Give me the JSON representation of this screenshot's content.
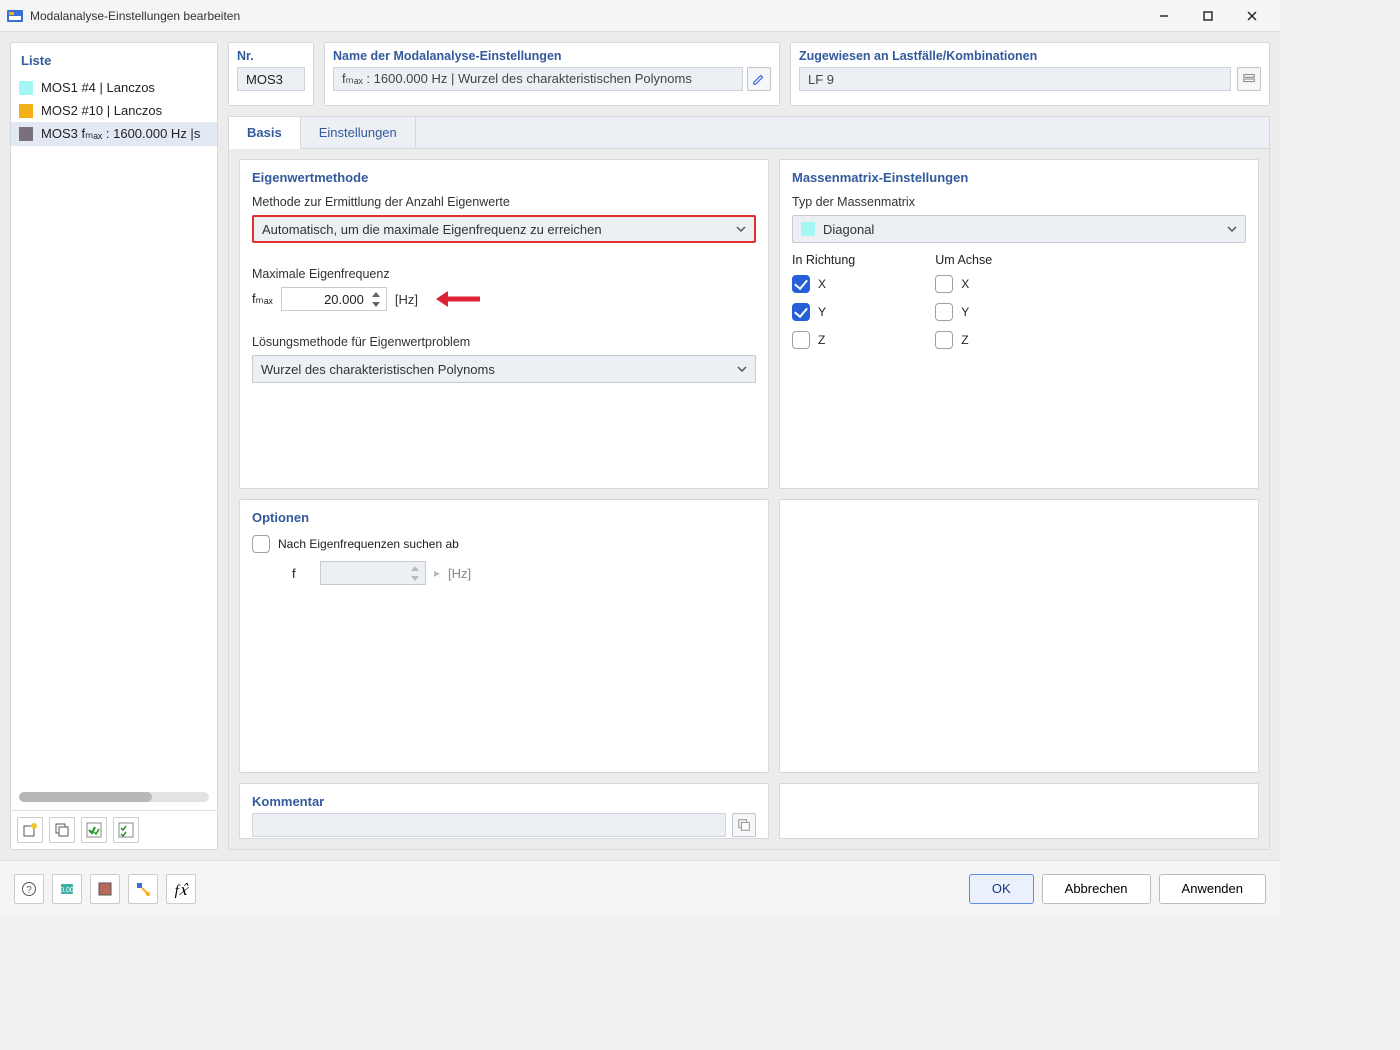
{
  "window": {
    "title": "Modalanalyse-Einstellungen bearbeiten"
  },
  "liste": {
    "heading": "Liste",
    "items": [
      {
        "color": "#a5f7f3",
        "label": "MOS1 #4 | Lanczos"
      },
      {
        "color": "#f4b117",
        "label": "MOS2 #10 | Lanczos"
      },
      {
        "color": "#7a6f7a",
        "label": "MOS3 fₘₐₓ : 1600.000 Hz |s"
      }
    ]
  },
  "top": {
    "nr_label": "Nr.",
    "nr_value": "MOS3",
    "name_label": "Name der Modalanalyse-Einstellungen",
    "name_value": "fₘₐₓ : 1600.000 Hz | Wurzel des charakteristischen Polynoms",
    "assign_label": "Zugewiesen an Lastfälle/Kombinationen",
    "assign_value": "LF 9"
  },
  "tabs": {
    "items": [
      "Basis",
      "Einstellungen"
    ],
    "active": 0
  },
  "eigen": {
    "title": "Eigenwertmethode",
    "method_label": "Methode zur Ermittlung der Anzahl Eigenwerte",
    "method_value": "Automatisch, um die maximale Eigenfrequenz zu erreichen",
    "maxfreq_label": "Maximale Eigenfrequenz",
    "fmax_symbol": "fₘₐₓ",
    "fmax_value": "20.000",
    "fmax_unit": "[Hz]",
    "solver_label": "Lösungsmethode für Eigenwertproblem",
    "solver_value": "Wurzel des charakteristischen Polynoms"
  },
  "mass": {
    "title": "Massenmatrix-Einstellungen",
    "type_label": "Typ der Massenmatrix",
    "type_value": "Diagonal",
    "type_color": "#a5f7f3",
    "dir_label": "In Richtung",
    "axis_label": "Um Achse",
    "dir": {
      "X": true,
      "Y": true,
      "Z": false
    },
    "axis": {
      "X": false,
      "Y": false,
      "Z": false
    },
    "labels": {
      "X": "X",
      "Y": "Y",
      "Z": "Z"
    }
  },
  "options": {
    "title": "Optionen",
    "search_label": "Nach Eigenfrequenzen suchen ab",
    "search_checked": false,
    "f_symbol": "f",
    "f_value": "",
    "f_unit": "[Hz]"
  },
  "kommentar": {
    "title": "Kommentar"
  },
  "footer": {
    "ok": "OK",
    "cancel": "Abbrechen",
    "apply": "Anwenden"
  }
}
